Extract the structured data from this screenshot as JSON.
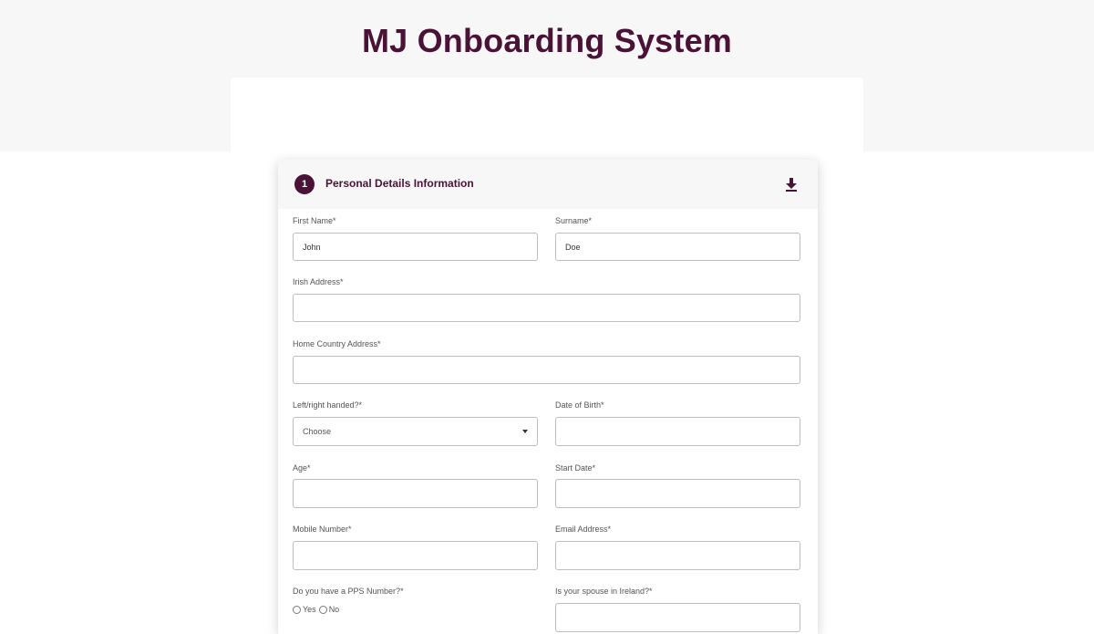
{
  "app": {
    "title": "MJ Onboarding System"
  },
  "section": {
    "step": "1",
    "title": "Personal Details Information",
    "collapse_icon": "arrow-down-icon"
  },
  "fields": {
    "first_name": {
      "label": "First Name*",
      "value": "John"
    },
    "surname": {
      "label": "Surname*",
      "value": "Doe"
    },
    "irish_address": {
      "label": "Irish Address*",
      "value": ""
    },
    "home_country_address": {
      "label": "Home Country Address*",
      "value": ""
    },
    "handedness": {
      "label": "Left/right handed?*",
      "selected": "Choose"
    },
    "date_of_birth": {
      "label": "Date of Birth*",
      "value": ""
    },
    "age": {
      "label": "Age*",
      "value": ""
    },
    "start_date": {
      "label": "Start Date*",
      "value": ""
    },
    "mobile_number": {
      "label": "Mobile Number*",
      "value": ""
    },
    "email_address": {
      "label": "Email Address*",
      "value": ""
    },
    "pps_number": {
      "label": "Do you have a PPS Number?*",
      "options": [
        "Yes",
        "No"
      ]
    },
    "spouse_in_ireland": {
      "label": "Is your spouse in Ireland?*",
      "value": ""
    }
  },
  "colors": {
    "brand": "#4a1236",
    "header_bg": "#f7f7f7",
    "border": "#bdbdbd"
  }
}
